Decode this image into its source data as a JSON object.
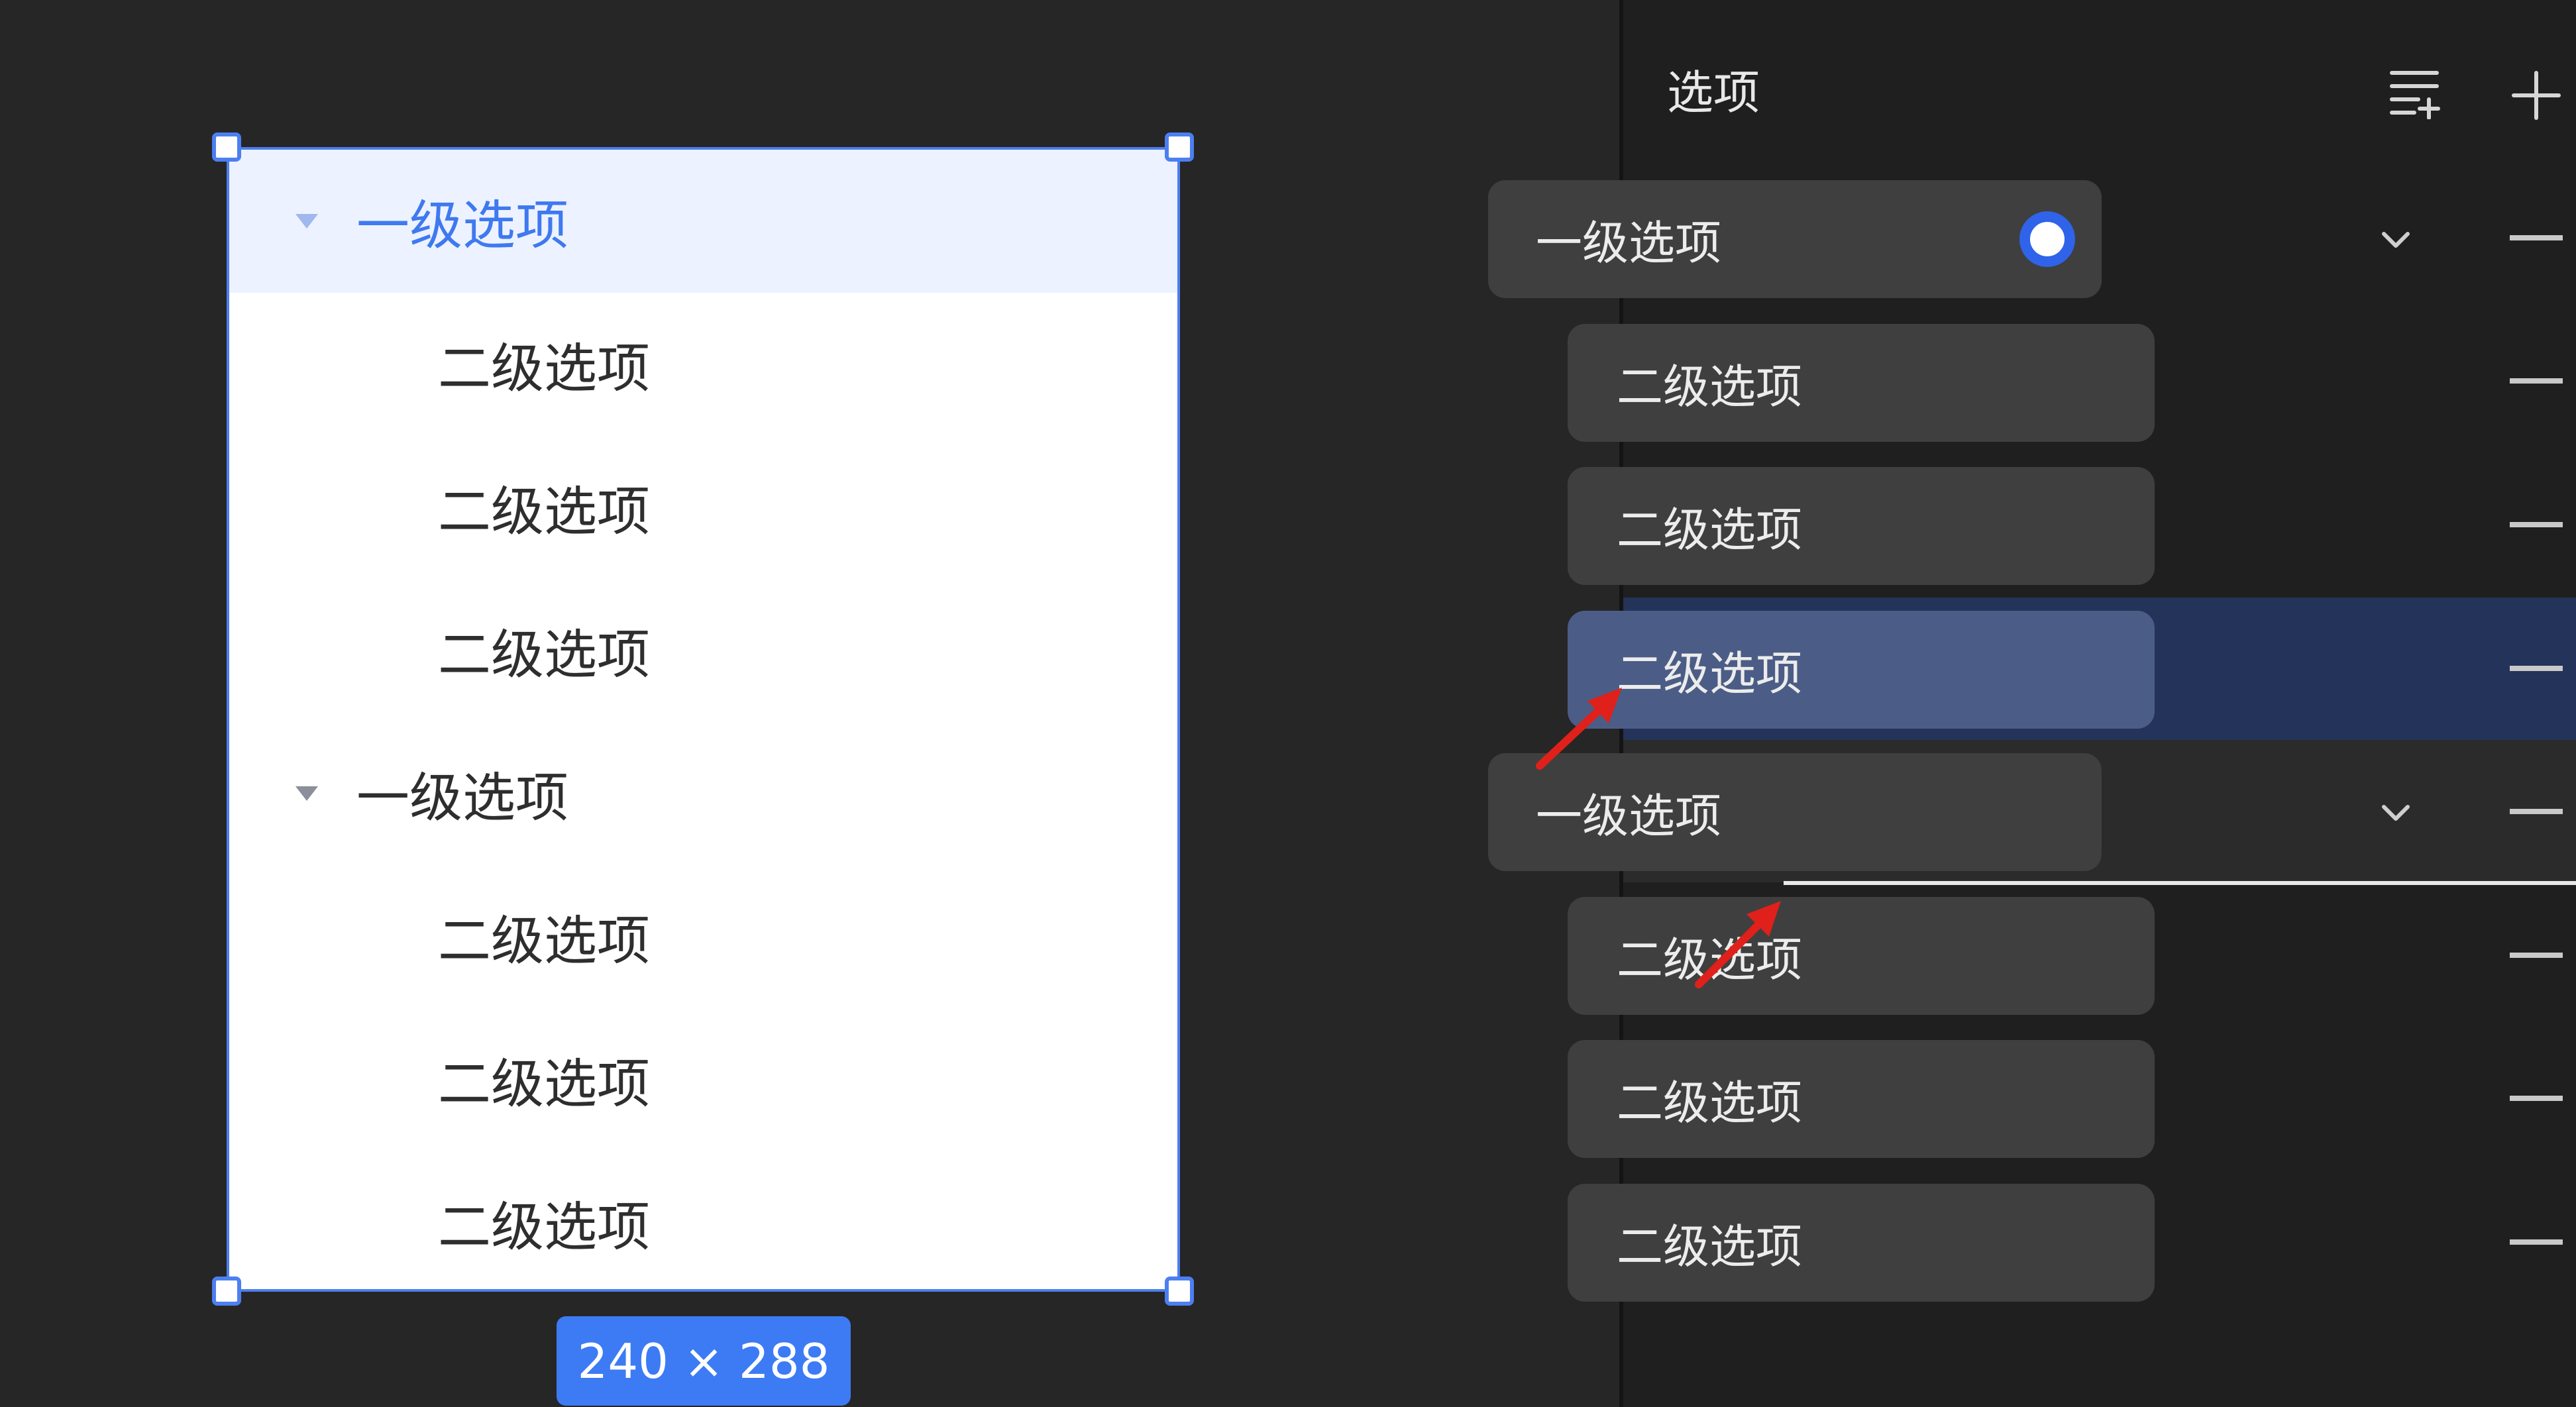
{
  "canvas": {
    "menu_preview": {
      "items": [
        {
          "label": "一级选项",
          "level": 1,
          "selected": true
        },
        {
          "label": "二级选项",
          "level": 2
        },
        {
          "label": "二级选项",
          "level": 2
        },
        {
          "label": "二级选项",
          "level": 2
        },
        {
          "label": "一级选项",
          "level": 1
        },
        {
          "label": "二级选项",
          "level": 2
        },
        {
          "label": "二级选项",
          "level": 2
        },
        {
          "label": "二级选项",
          "level": 2
        }
      ]
    },
    "size_badge": "240 × 288"
  },
  "panel": {
    "title": "选项",
    "toolbar_icons": [
      "list-add-icon",
      "plus-icon"
    ],
    "rows": [
      {
        "label": "一级选项",
        "level": 1,
        "expanded": true,
        "default_checked": true
      },
      {
        "label": "二级选项",
        "level": 2
      },
      {
        "label": "二级选项",
        "level": 2
      },
      {
        "label": "二级选项",
        "level": 2,
        "state": "dragging"
      },
      {
        "label": "一级选项",
        "level": 1,
        "expanded": true,
        "state": "drop-target"
      },
      {
        "label": "二级选项",
        "level": 2
      },
      {
        "label": "二级选项",
        "level": 2
      },
      {
        "label": "二级选项",
        "level": 2
      }
    ]
  },
  "colors": {
    "accent": "#3d7bf4",
    "selection_border": "#4c7ff0",
    "selected_text": "#3f79f0",
    "annotation_arrow": "#e0201a"
  }
}
